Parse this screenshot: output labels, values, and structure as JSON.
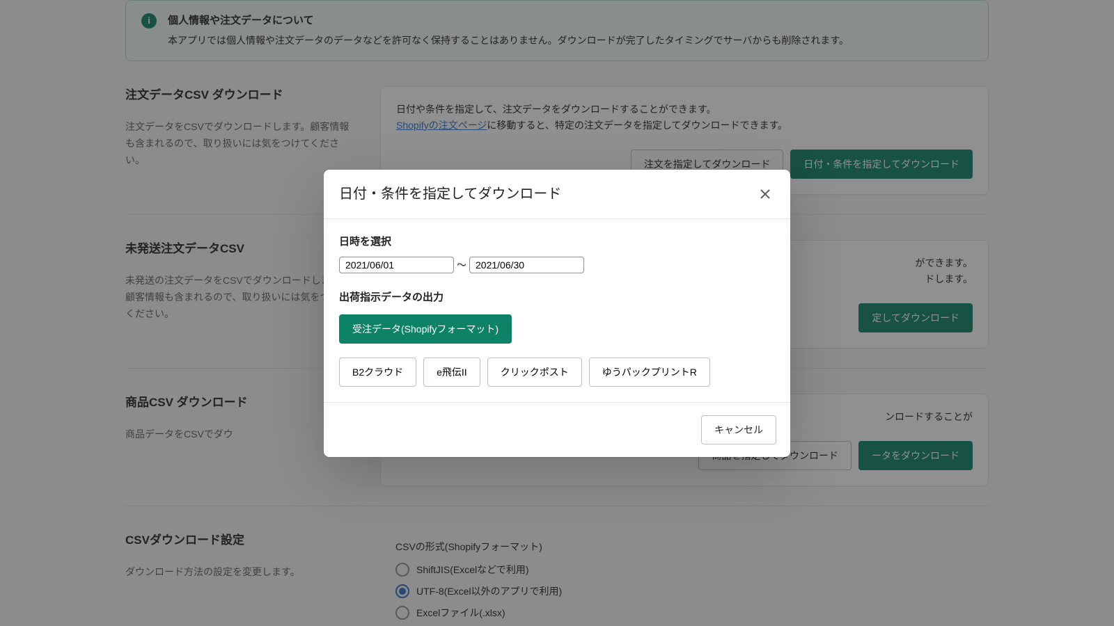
{
  "info": {
    "title": "個人情報や注文データについて",
    "text": "本アプリでは個人情報や注文データのデータなどを許可なく保持することはありません。ダウンロードが完了したタイミングでサーバからも削除されます。"
  },
  "sections": {
    "orders": {
      "title": "注文データCSV ダウンロード",
      "desc": "注文データをCSVでダウンロードします。顧客情報も含まれるので、取り扱いには気をつけてください。",
      "right_text1": "日付や条件を指定して、注文データをダウンロードすることができます。",
      "link_text": "Shopifyの注文ページ",
      "right_text2": "に移動すると、特定の注文データを指定してダウンロードできます。",
      "btn_secondary": "注文を指定してダウンロード",
      "btn_primary": "日付・条件を指定してダウンロード"
    },
    "unshipped": {
      "title": "未発送注文データCSV",
      "desc": "未発送の注文データをCSVでダウンロードします。顧客情報も含まれるので、取り扱いには気をつけてください。",
      "right_text1": "ができます。",
      "right_text2": "ドします。",
      "btn_primary": "定してダウンロード"
    },
    "products": {
      "title": "商品CSV ダウンロード",
      "desc": "商品データをCSVでダウ",
      "right_text": "ンロードすることが",
      "btn_secondary": "商品を指定してダウンロード",
      "btn_primary": "ータをダウンロード"
    },
    "settings": {
      "title": "CSVダウンロード設定",
      "desc": "ダウンロード方法の設定を変更します。",
      "format_heading": "CSVの形式(Shopifyフォーマット)",
      "radios": [
        {
          "label": "ShiftJIS(Excelなどで利用)",
          "selected": false
        },
        {
          "label": "UTF-8(Excel以外のアプリで利用)",
          "selected": true
        },
        {
          "label": "Excelファイル(.xlsx)",
          "selected": false
        }
      ]
    }
  },
  "modal": {
    "title": "日付・条件を指定してダウンロード",
    "date_label": "日時を選択",
    "date_from": "2021/06/01",
    "date_to": "2021/06/30",
    "tilde": "〜",
    "format_label": "出荷指示データの出力",
    "format_buttons": [
      {
        "label": "受注データ(Shopifyフォーマット)",
        "active": true
      },
      {
        "label": "B2クラウド",
        "active": false
      },
      {
        "label": "e飛伝II",
        "active": false
      },
      {
        "label": "クリックポスト",
        "active": false
      },
      {
        "label": "ゆうパックプリントR",
        "active": false
      }
    ],
    "cancel": "キャンセル"
  }
}
